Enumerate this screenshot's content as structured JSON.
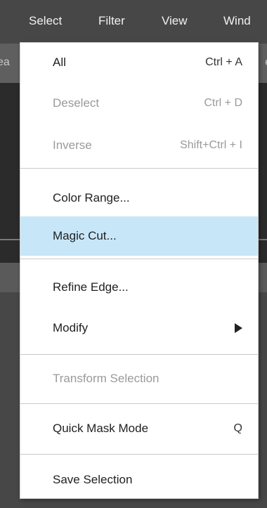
{
  "menubar": {
    "items": [
      "Select",
      "Filter",
      "View",
      "Wind"
    ]
  },
  "tabbar": {
    "left_fragment": "ea",
    "right_fragment": "e"
  },
  "menu": {
    "items": [
      {
        "label": "All",
        "shortcut": "Ctrl + A",
        "enabled": true
      },
      {
        "label": "Deselect",
        "shortcut": "Ctrl + D",
        "enabled": false
      },
      {
        "label": "Inverse",
        "shortcut": "Shift+Ctrl + I",
        "enabled": false
      },
      {
        "label": "Color Range...",
        "shortcut": "",
        "enabled": true
      },
      {
        "label": "Magic Cut...",
        "shortcut": "",
        "enabled": true,
        "highlighted": true
      },
      {
        "label": "Refine Edge...",
        "shortcut": "",
        "enabled": true
      },
      {
        "label": "Modify",
        "shortcut": "",
        "enabled": true,
        "submenu": true,
        "submenu_icon": "chevron-right-icon"
      },
      {
        "label": "Transform Selection",
        "shortcut": "",
        "enabled": false
      },
      {
        "label": "Quick Mask Mode",
        "shortcut": "Q",
        "enabled": true
      },
      {
        "label": "Save Selection",
        "shortcut": "",
        "enabled": true
      }
    ]
  },
  "colors": {
    "menubar_bg": "#474747",
    "menu_bg": "#ffffff",
    "highlight_bg": "#c7e7f8",
    "disabled_text": "#9a9a9a"
  }
}
